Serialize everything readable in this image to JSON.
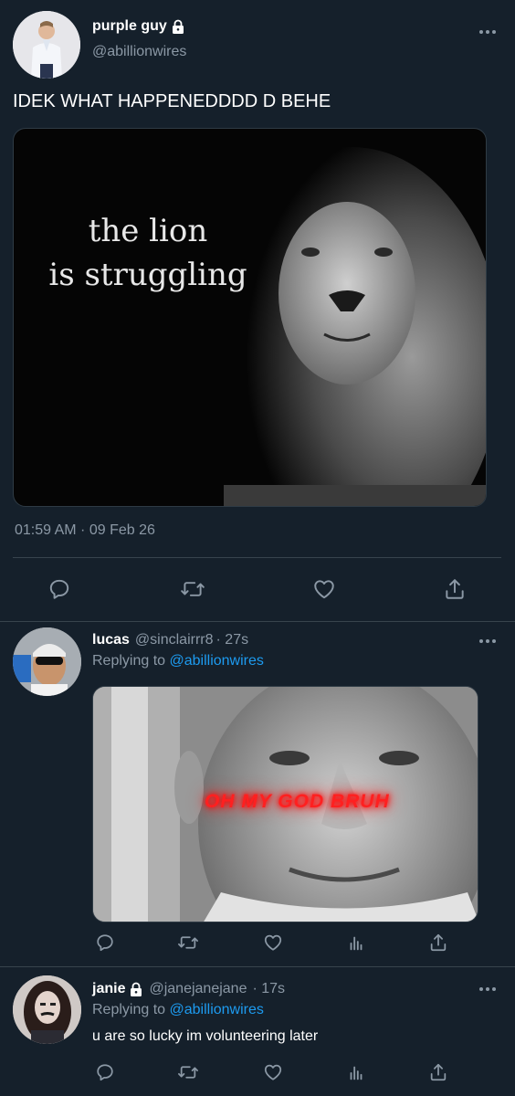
{
  "main_tweet": {
    "display_name": "purple guy",
    "handle": "@abillionwires",
    "text": "IDEK WHAT HAPPENEDDDD D BEHE",
    "image_caption_line1": "the lion",
    "image_caption_line2": "is struggling",
    "timestamp": "01:59 AM · 09 Feb 26"
  },
  "replies": [
    {
      "display_name": "lucas",
      "handle": "@sinclairrr8",
      "time": "· 27s",
      "replying_prefix": "Replying to",
      "replying_to": "@abillionwires",
      "image_overlay_text": "OH MY GOD BRUH"
    },
    {
      "display_name": "janie",
      "handle": "@janejanejane",
      "time": "· 17s",
      "replying_prefix": "Replying to",
      "replying_to": "@abillionwires",
      "text": "u are so lucky im volunteering later"
    }
  ],
  "colors": {
    "background": "#15202b",
    "link": "#1d9bf0",
    "muted": "#8b98a5",
    "divider": "#38444d",
    "overlay_red": "#ff2020"
  }
}
